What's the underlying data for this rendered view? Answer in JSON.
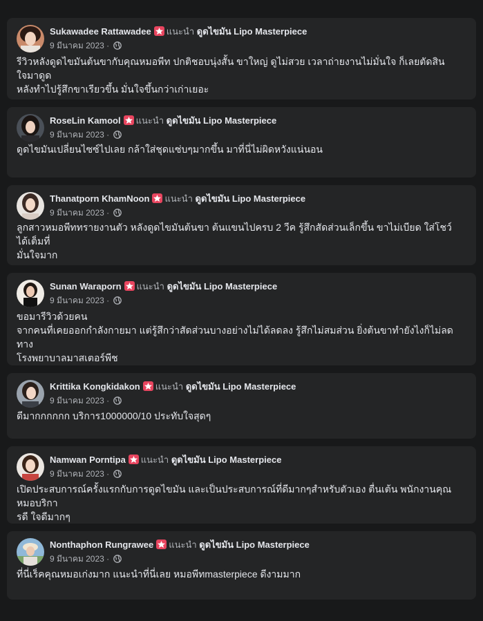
{
  "recommend_text": "แนะนำ",
  "page_name": "ดูดไขมัน Lipo Masterpiece",
  "date": "9 มีนาคม 2023 ·",
  "colors": {
    "background": "#18191a",
    "card": "#242526",
    "badge": "#e8455f",
    "muted": "#b0b3b8",
    "text": "#e4e6eb"
  },
  "icons": {
    "badge": "recommend-star-icon",
    "privacy": "globe-icon"
  },
  "reviews": [
    {
      "name": "Sukawadee Rattawadee",
      "text": "รีวิวหลังดูดไขมันต้นขากับคุณหมอพีท ปกติชอบนุ่งสั้น ขาใหญ่ ดูไม่สวย เวลาถ่ายงานไม่มั่นใจ ก็เลยตัดสินใจมาดูด\nหลังทำไปรู้สึกขาเรียวขึ้น มั่นใจขึ้นกว่าเก่าเยอะ"
    },
    {
      "name": "RoseLin Kamool",
      "text": "ดูดไขมันเปลี่ยนไซซ์ไปเลย กล้าใส่ชุดแซ่บๆมากขึ้น มาที่นี่ไม่ผิดหวังแน่นอน"
    },
    {
      "name": "Thanatporn KhamNoon",
      "text": "ลูกสาวหมอพีททรายงานตัว หลังดูดไขมันต้นขา ต้นแขนไปครบ 2 วีค รู้สึกสัดส่วนเล็กขึ้น ขาไม่เบียด ใส่โชว์ได้เต็มที่\nมั่นใจมาก"
    },
    {
      "name": "Sunan Waraporn",
      "text": "ขอมารีวิวด้วยคน\nจากคนที่เคยออกกำลังกายมา แต่รู้สึกว่าสัดส่วนบางอย่างไม่ได้ลดลง รู้สึกไม่สมส่วน ยิ่งต้นขาทำยังไงก็ไม่ลด ทาง\nโรงพยาบาลมาสเตอร์พีช"
    },
    {
      "name": "Krittika Kongkidakon",
      "text": "ดีมากกกกกก  บริการ1000000/10 ประทับใจสุดๆ"
    },
    {
      "name": "Namwan Porntipa",
      "text": "เปิดประสบการณ์ครั้งแรกกับการดูดไขมัน และเป็นประสบการณ์ที่ดีมากๆสำหรับตัวเอง ตื่นเต้น พนักงานคุณหมอบริกา\nรดี ใจดีมากๆ"
    },
    {
      "name": "Nonthaphon Rungrawee",
      "text": "ที่นี่เร็คคุณหมอเก่งมาก แนะนำที่นี่เลย หมอพีทmasterpiece ดีงามมาก"
    }
  ]
}
